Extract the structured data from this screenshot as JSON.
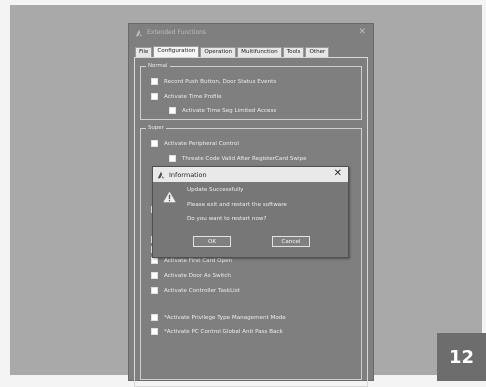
{
  "window": {
    "title": "Extended Functions",
    "close_glyph": "✕"
  },
  "tabs": [
    {
      "label": "File",
      "active": false
    },
    {
      "label": "Configuration",
      "active": true
    },
    {
      "label": "Operation",
      "active": false
    },
    {
      "label": "Multifunction",
      "active": false
    },
    {
      "label": "Tools",
      "active": false
    },
    {
      "label": "Other",
      "active": false
    }
  ],
  "normal_group": {
    "label": "Normal",
    "options": [
      "Record Push Button, Door Status Events",
      "Activate Time Profile",
      "Activate Time Seg Limited Access"
    ]
  },
  "super_group": {
    "label": "Super",
    "options_top": [
      "Activate Peripheral Control",
      "Threate Code Valid After RegisterCard Swipe"
    ],
    "options_bottom": [
      "Activate First Card Open",
      "Activate Door As Switch",
      "Activate Controller TaskList"
    ],
    "options_extra": [
      "*Activate Privilege Type Management Mode",
      "*Activate PC Control Global Anti Pass Back"
    ]
  },
  "dialog": {
    "title": "Information",
    "close_glyph": "✕",
    "icon": "warning-icon",
    "lines": [
      "Update Successfully",
      "Please exit and restart the software",
      "Do you want to restart now?"
    ],
    "ok_label": "OK",
    "cancel_label": "Cancel"
  },
  "page_number": "12",
  "colors": {
    "backdrop": "#a9a9a9",
    "window": "#7f7f7f",
    "dialog_title": "#e9e9e9",
    "page_badge": "#6d6d6d"
  }
}
